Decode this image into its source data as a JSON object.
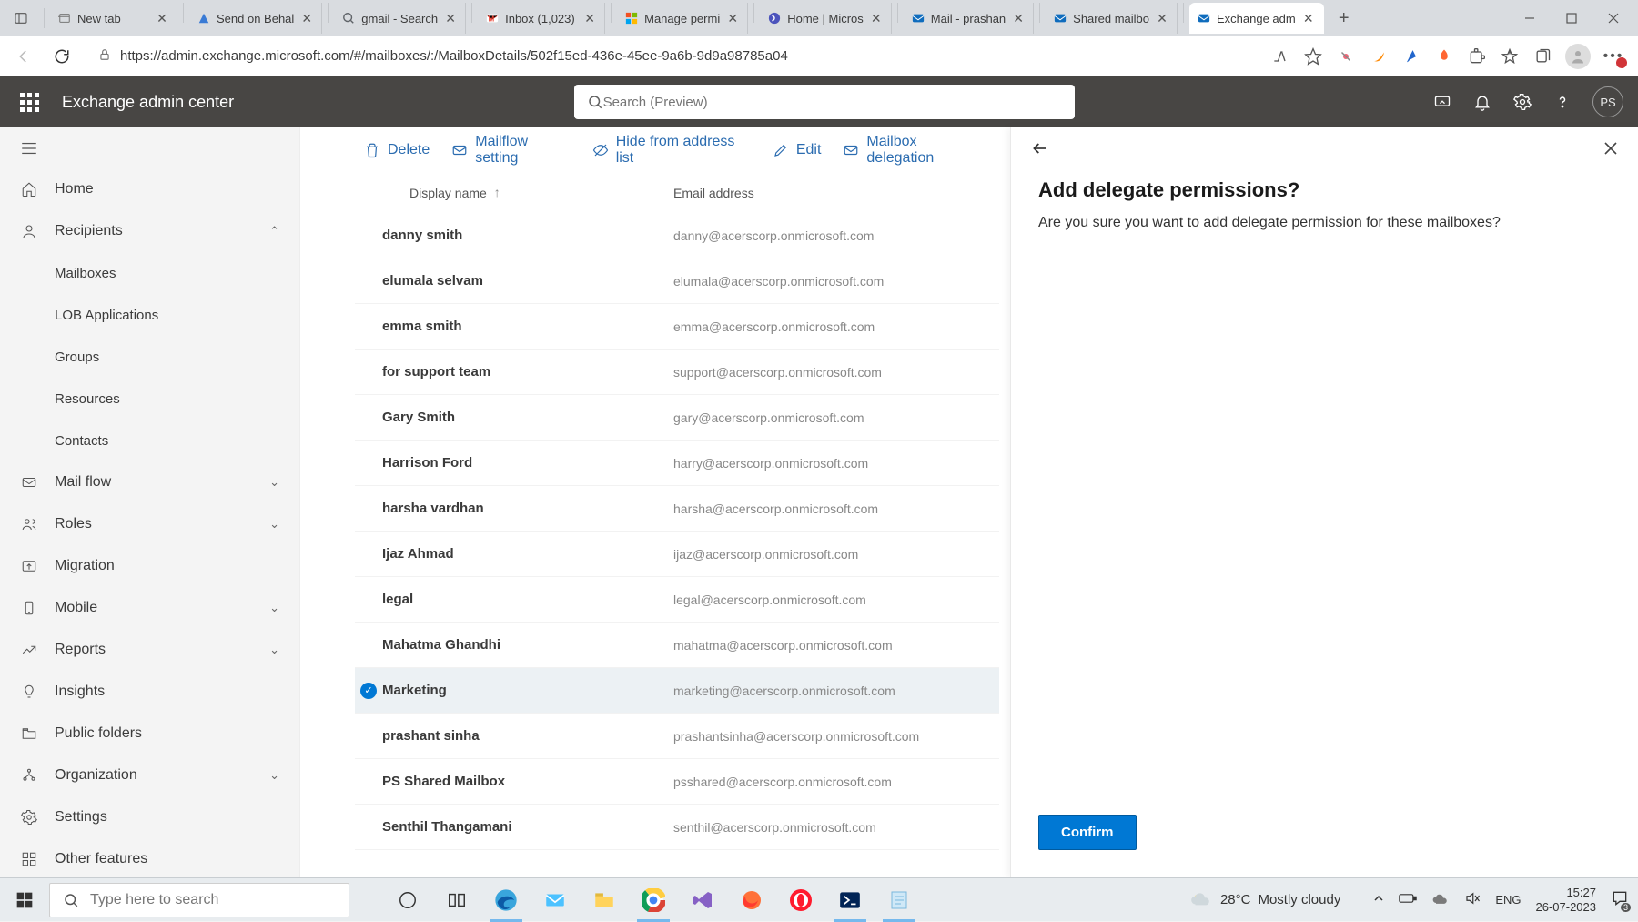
{
  "browser": {
    "tabs": [
      {
        "title": "New tab"
      },
      {
        "title": "Send on Behal"
      },
      {
        "title": "gmail - Search"
      },
      {
        "title": "Inbox (1,023)"
      },
      {
        "title": "Manage permi"
      },
      {
        "title": "Home | Micros"
      },
      {
        "title": "Mail - prashan"
      },
      {
        "title": "Shared mailbo"
      },
      {
        "title": "Exchange adm"
      }
    ],
    "url": "https://admin.exchange.microsoft.com/#/mailboxes/:/MailboxDetails/502f15ed-436e-45ee-9a6b-9d9a98785a04"
  },
  "header": {
    "app_title": "Exchange admin center",
    "search_placeholder": "Search (Preview)",
    "avatar_initials": "PS"
  },
  "sidebar": {
    "items": [
      {
        "label": "Home",
        "icon": "home"
      },
      {
        "label": "Recipients",
        "icon": "user",
        "expandable": true,
        "expanded": true,
        "children": [
          {
            "label": "Mailboxes"
          },
          {
            "label": "LOB Applications"
          },
          {
            "label": "Groups"
          },
          {
            "label": "Resources"
          },
          {
            "label": "Contacts"
          }
        ]
      },
      {
        "label": "Mail flow",
        "icon": "mail",
        "expandable": true
      },
      {
        "label": "Roles",
        "icon": "roles",
        "expandable": true
      },
      {
        "label": "Migration",
        "icon": "migration"
      },
      {
        "label": "Mobile",
        "icon": "mobile",
        "expandable": true
      },
      {
        "label": "Reports",
        "icon": "reports",
        "expandable": true
      },
      {
        "label": "Insights",
        "icon": "insights"
      },
      {
        "label": "Public folders",
        "icon": "folder"
      },
      {
        "label": "Organization",
        "icon": "org",
        "expandable": true
      },
      {
        "label": "Settings",
        "icon": "gear"
      },
      {
        "label": "Other features",
        "icon": "other"
      }
    ]
  },
  "toolbar": {
    "delete": "Delete",
    "mailflow": "Mailflow setting",
    "hide": "Hide from address list",
    "edit": "Edit",
    "delegation": "Mailbox delegation"
  },
  "grid": {
    "col_name": "Display name",
    "col_email": "Email address",
    "rows": [
      {
        "name": "danny smith",
        "email": "danny@acerscorp.onmicrosoft.com"
      },
      {
        "name": "elumala selvam",
        "email": "elumala@acerscorp.onmicrosoft.com"
      },
      {
        "name": "emma smith",
        "email": "emma@acerscorp.onmicrosoft.com"
      },
      {
        "name": "for support team",
        "email": "support@acerscorp.onmicrosoft.com"
      },
      {
        "name": "Gary Smith",
        "email": "gary@acerscorp.onmicrosoft.com"
      },
      {
        "name": "Harrison Ford",
        "email": "harry@acerscorp.onmicrosoft.com"
      },
      {
        "name": "harsha vardhan",
        "email": "harsha@acerscorp.onmicrosoft.com"
      },
      {
        "name": "Ijaz Ahmad",
        "email": "ijaz@acerscorp.onmicrosoft.com"
      },
      {
        "name": "legal",
        "email": "legal@acerscorp.onmicrosoft.com"
      },
      {
        "name": "Mahatma Ghandhi",
        "email": "mahatma@acerscorp.onmicrosoft.com"
      },
      {
        "name": "Marketing",
        "email": "marketing@acerscorp.onmicrosoft.com",
        "selected": true
      },
      {
        "name": "prashant sinha",
        "email": "prashantsinha@acerscorp.onmicrosoft.com"
      },
      {
        "name": "PS Shared Mailbox",
        "email": "psshared@acerscorp.onmicrosoft.com"
      },
      {
        "name": "Senthil Thangamani",
        "email": "senthil@acerscorp.onmicrosoft.com"
      }
    ]
  },
  "panel": {
    "heading": "Add delegate permissions?",
    "body": "Are you sure you want to add delegate permission for these mailboxes?",
    "confirm": "Confirm"
  },
  "taskbar": {
    "search_placeholder": "Type here to search",
    "weather_temp": "28°C",
    "weather_desc": "Mostly cloudy",
    "lang": "ENG",
    "time": "15:27",
    "date": "26-07-2023"
  }
}
